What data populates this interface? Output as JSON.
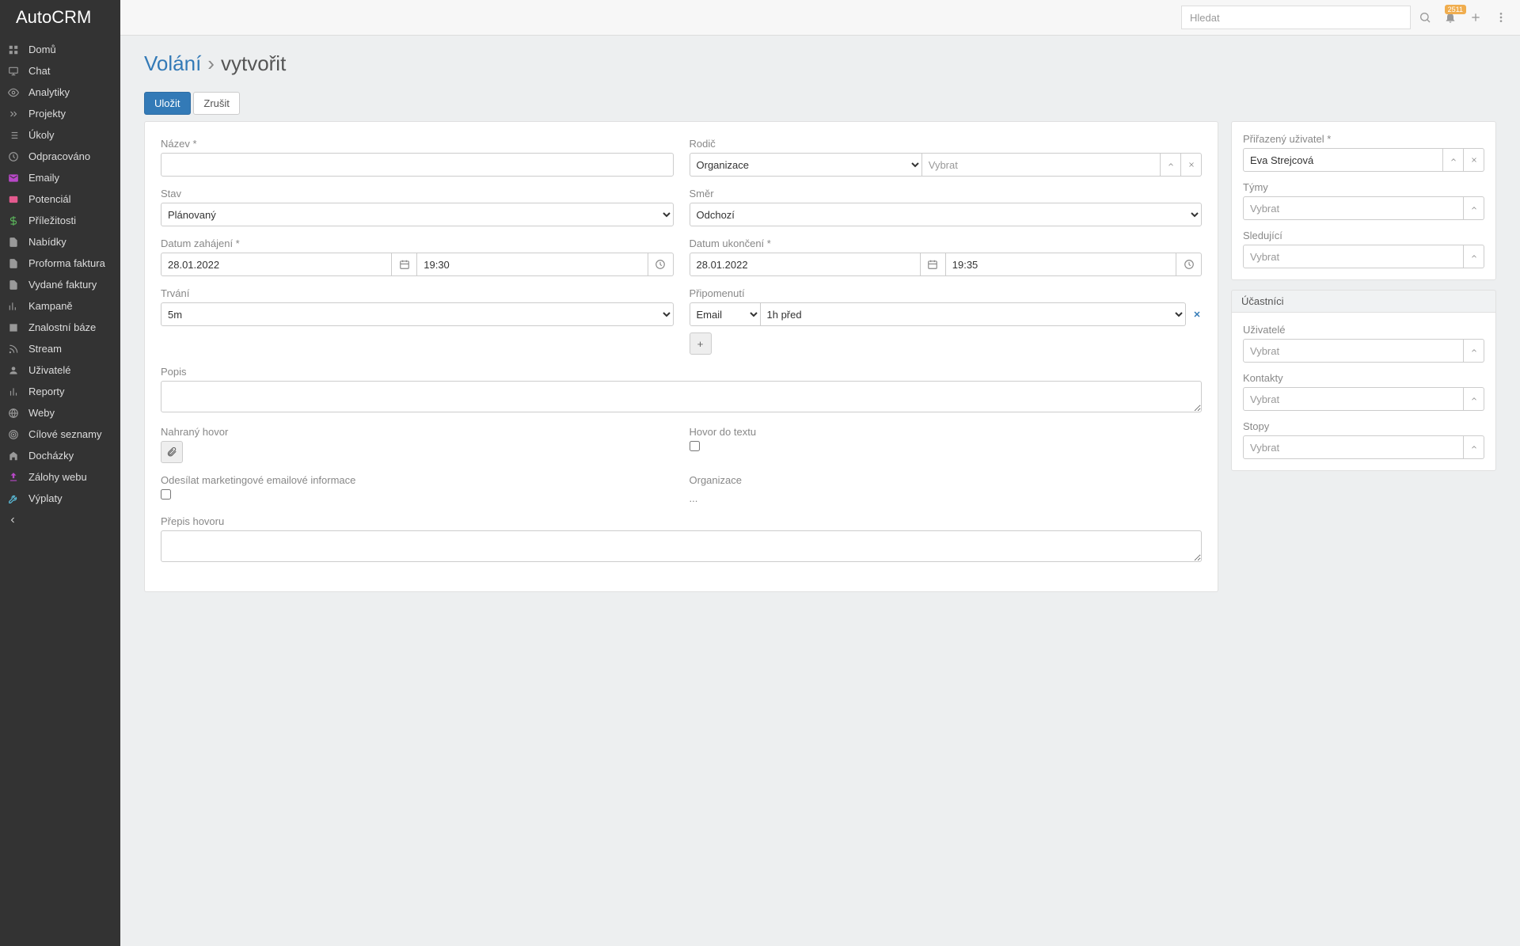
{
  "app": {
    "name": "AutoCRM"
  },
  "search": {
    "placeholder": "Hledat"
  },
  "notif_count": "2511",
  "sidebar": {
    "items": [
      {
        "label": "Domů"
      },
      {
        "label": "Chat"
      },
      {
        "label": "Analytiky"
      },
      {
        "label": "Projekty"
      },
      {
        "label": "Úkoly"
      },
      {
        "label": "Odpracováno"
      },
      {
        "label": "Emaily"
      },
      {
        "label": "Potenciál"
      },
      {
        "label": "Příležitosti"
      },
      {
        "label": "Nabídky"
      },
      {
        "label": "Proforma faktura"
      },
      {
        "label": "Vydané faktury"
      },
      {
        "label": "Kampaně"
      },
      {
        "label": "Znalostní báze"
      },
      {
        "label": "Stream"
      },
      {
        "label": "Uživatelé"
      },
      {
        "label": "Reporty"
      },
      {
        "label": "Weby"
      },
      {
        "label": "Cílové seznamy"
      },
      {
        "label": "Docházky"
      },
      {
        "label": "Zálohy webu"
      },
      {
        "label": "Výplaty"
      }
    ]
  },
  "page": {
    "entity": "Volání",
    "sep": "›",
    "action": "vytvořit"
  },
  "buttons": {
    "save": "Uložit",
    "cancel": "Zrušit",
    "add": "+"
  },
  "form": {
    "name_label": "Název *",
    "parent_label": "Rodič",
    "parent_type": "Organizace",
    "parent_placeholder": "Vybrat",
    "status_label": "Stav",
    "status_value": "Plánovaný",
    "direction_label": "Směr",
    "direction_value": "Odchozí",
    "date_start_label": "Datum zahájení *",
    "date_start": "28.01.2022",
    "time_start": "19:30",
    "date_end_label": "Datum ukončení *",
    "date_end": "28.01.2022",
    "time_end": "19:35",
    "duration_label": "Trvání",
    "duration_value": "5m",
    "reminder_label": "Připomenutí",
    "reminder_type": "Email",
    "reminder_time": "1h před",
    "description_label": "Popis",
    "recording_label": "Nahraný hovor",
    "speech2text_label": "Hovor do textu",
    "marketing_label": "Odesílat marketingové emailové informace",
    "org_label": "Organizace",
    "org_value": "...",
    "transcript_label": "Přepis hovoru"
  },
  "side": {
    "assigned_label": "Přiřazený uživatel *",
    "assigned_value": "Eva Strejcová",
    "teams_label": "Týmy",
    "followers_label": "Sledující",
    "participants_header": "Účastníci",
    "users_label": "Uživatelé",
    "contacts_label": "Kontakty",
    "leads_label": "Stopy",
    "select_placeholder": "Vybrat"
  }
}
